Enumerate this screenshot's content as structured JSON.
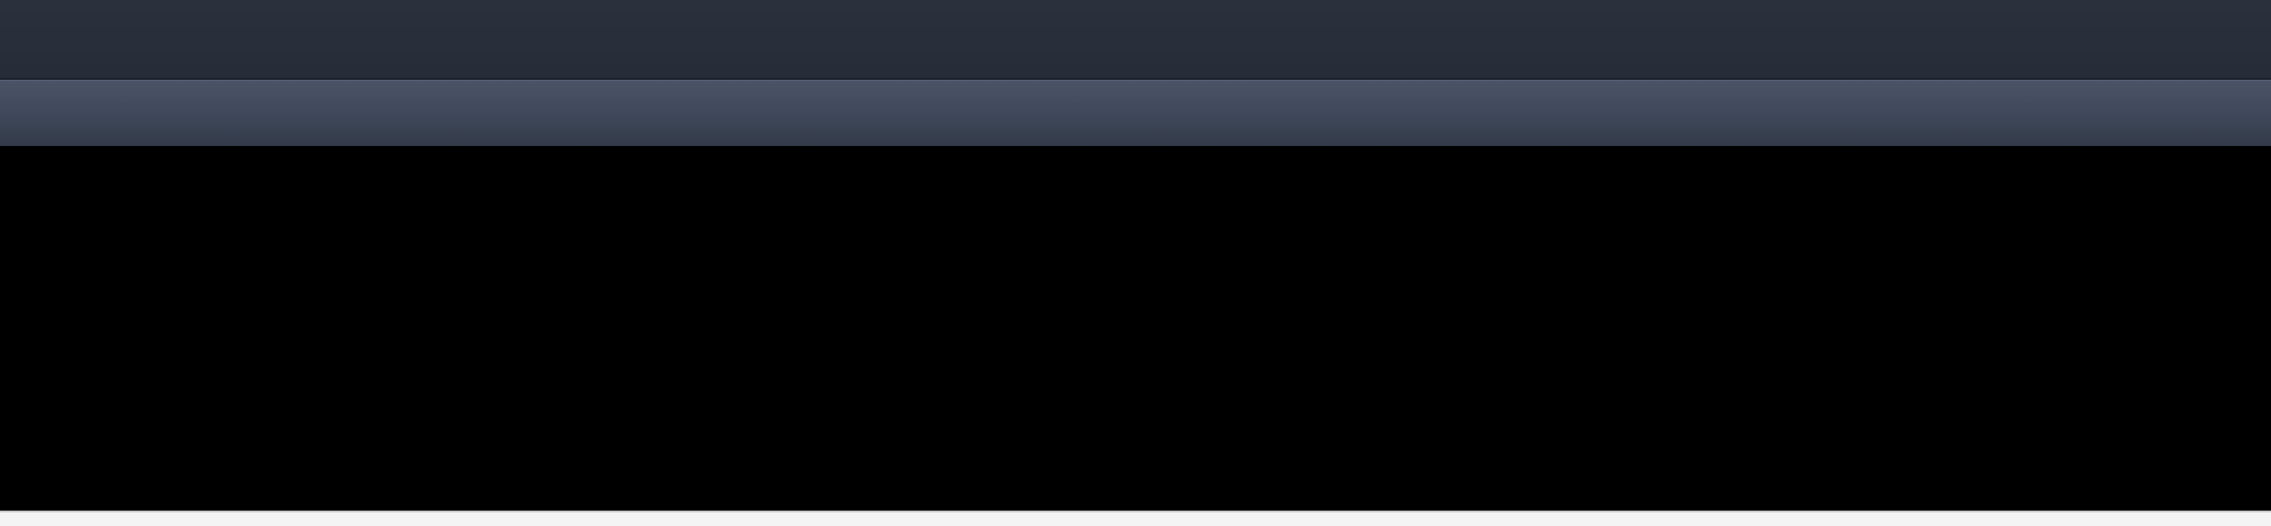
{
  "window": {
    "title": "",
    "toolbar_text": ""
  },
  "colors": {
    "title_bar": "#272d39",
    "toolbar_top": "#4a5466",
    "toolbar_bottom": "#333b49",
    "content_background": "#000000",
    "bottom_edge": "#f4f4f4"
  }
}
